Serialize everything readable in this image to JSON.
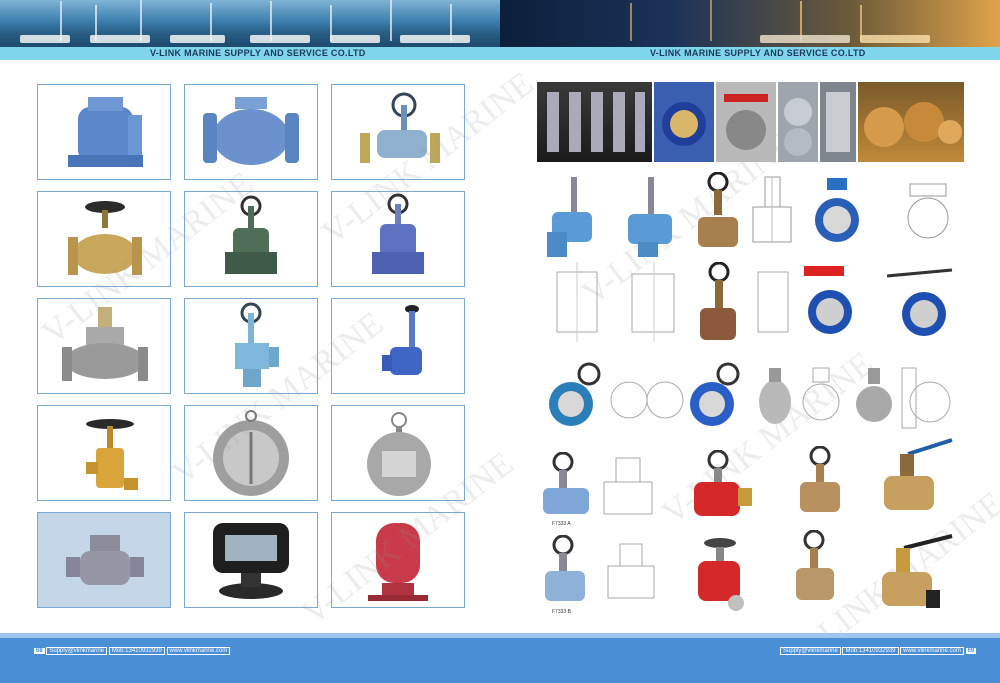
{
  "header": {
    "left_title": "V-LINK MARINE SUPPLY AND SERVICE CO.LTD",
    "right_title": "V-LINK MARINE SUPPLY AND SERVICE CO.LTD"
  },
  "watermark": {
    "text": "V-LINK MARINE"
  },
  "captions": {
    "fig_a": "F7333 A",
    "fig_b": "F7333 B"
  },
  "footer": {
    "left_page": "68",
    "right_page": "69",
    "email": "Supply@vlinkmarine",
    "mobile": "Mob:13410932939",
    "website": "www.vlinkmarine.com"
  },
  "colors": {
    "accent": "#4a8fd6",
    "title_bar": "#7fd6ea",
    "cell_border": "#7aa9d8"
  }
}
